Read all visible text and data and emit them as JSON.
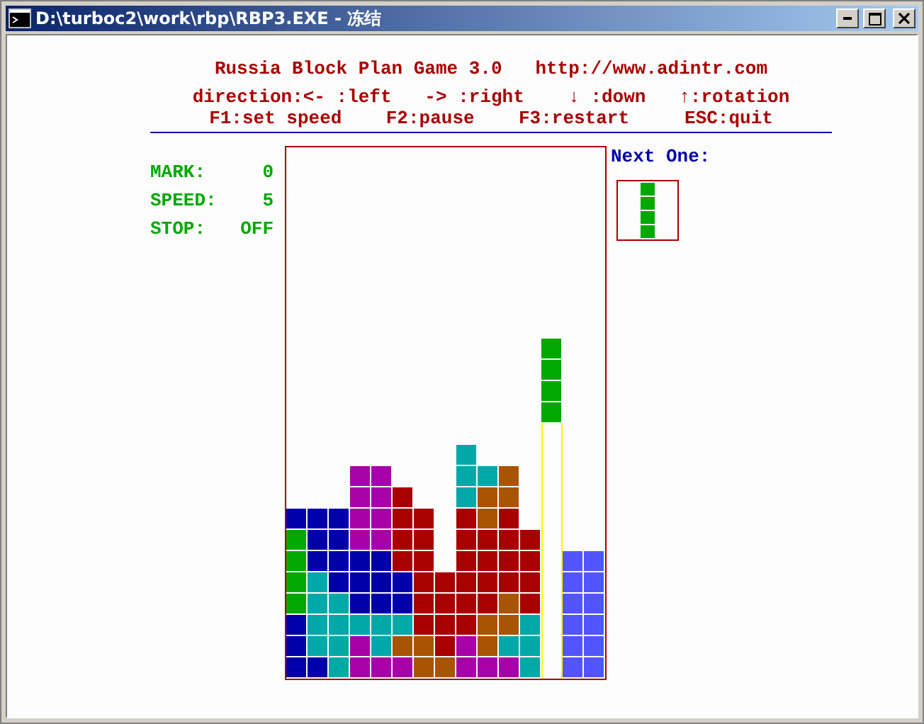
{
  "window": {
    "title": "D:\\turboc2\\work\\rbp\\RBP3.EXE - 冻结"
  },
  "header": {
    "title_line": "Russia Block Plan Game 3.0   http://www.adintr.com",
    "controls_line": "direction:<- :left   -> :right    ↓ :down   ↑:rotation",
    "keys_line": "F1:set speed    F2:pause    F3:restart     ESC:quit"
  },
  "stats": [
    {
      "label": "MARK:",
      "value": "0"
    },
    {
      "label": "SPEED:",
      "value": "5"
    },
    {
      "label": "STOP:",
      "value": "OFF"
    }
  ],
  "board": {
    "rows": [
      {
        "cells": [
          {
            "kind": "empty"
          },
          {
            "kind": "empty"
          },
          {
            "kind": "empty"
          },
          {
            "kind": "empty"
          },
          {
            "kind": "empty"
          },
          {
            "kind": "empty"
          },
          {
            "kind": "empty"
          },
          {
            "kind": "empty"
          },
          {
            "kind": "empty"
          },
          {
            "kind": "empty"
          },
          {
            "kind": "empty"
          },
          {
            "kind": "empty"
          },
          {
            "kind": "falling",
            "color": "#00a800"
          },
          {
            "kind": "empty"
          },
          {
            "kind": "empty"
          }
        ]
      },
      {
        "cells": [
          {
            "kind": "empty"
          },
          {
            "kind": "empty"
          },
          {
            "kind": "empty"
          },
          {
            "kind": "empty"
          },
          {
            "kind": "empty"
          },
          {
            "kind": "empty"
          },
          {
            "kind": "empty"
          },
          {
            "kind": "empty"
          },
          {
            "kind": "empty"
          },
          {
            "kind": "empty"
          },
          {
            "kind": "empty"
          },
          {
            "kind": "empty"
          },
          {
            "kind": "falling",
            "color": "#00a800"
          },
          {
            "kind": "empty"
          },
          {
            "kind": "empty"
          }
        ]
      },
      {
        "cells": [
          {
            "kind": "empty"
          },
          {
            "kind": "empty"
          },
          {
            "kind": "empty"
          },
          {
            "kind": "empty"
          },
          {
            "kind": "empty"
          },
          {
            "kind": "empty"
          },
          {
            "kind": "empty"
          },
          {
            "kind": "empty"
          },
          {
            "kind": "empty"
          },
          {
            "kind": "empty"
          },
          {
            "kind": "empty"
          },
          {
            "kind": "empty"
          },
          {
            "kind": "falling",
            "color": "#00a800"
          },
          {
            "kind": "empty"
          },
          {
            "kind": "empty"
          }
        ]
      },
      {
        "cells": [
          {
            "kind": "empty"
          },
          {
            "kind": "empty"
          },
          {
            "kind": "empty"
          },
          {
            "kind": "empty"
          },
          {
            "kind": "empty"
          },
          {
            "kind": "empty"
          },
          {
            "kind": "empty"
          },
          {
            "kind": "empty"
          },
          {
            "kind": "empty"
          },
          {
            "kind": "empty"
          },
          {
            "kind": "empty"
          },
          {
            "kind": "empty"
          },
          {
            "kind": "falling",
            "color": "#00a800"
          },
          {
            "kind": "empty"
          },
          {
            "kind": "empty"
          }
        ]
      },
      {
        "cells": [
          {
            "kind": "empty"
          },
          {
            "kind": "empty"
          },
          {
            "kind": "empty"
          },
          {
            "kind": "empty"
          },
          {
            "kind": "empty"
          },
          {
            "kind": "empty"
          },
          {
            "kind": "empty"
          },
          {
            "kind": "empty"
          },
          {
            "kind": "empty"
          },
          {
            "kind": "empty"
          },
          {
            "kind": "empty"
          },
          {
            "kind": "empty"
          },
          {
            "kind": "guide"
          },
          {
            "kind": "empty"
          },
          {
            "kind": "empty"
          }
        ]
      },
      {
        "cells": [
          {
            "kind": "empty"
          },
          {
            "kind": "empty"
          },
          {
            "kind": "empty"
          },
          {
            "kind": "empty"
          },
          {
            "kind": "empty"
          },
          {
            "kind": "empty"
          },
          {
            "kind": "empty"
          },
          {
            "kind": "empty"
          },
          {
            "kind": "block",
            "color": "#00a8a8"
          },
          {
            "kind": "empty"
          },
          {
            "kind": "empty"
          },
          {
            "kind": "empty"
          },
          {
            "kind": "guide"
          },
          {
            "kind": "empty"
          },
          {
            "kind": "empty"
          }
        ]
      },
      {
        "cells": [
          {
            "kind": "empty"
          },
          {
            "kind": "empty"
          },
          {
            "kind": "empty"
          },
          {
            "kind": "block",
            "color": "#a800a8"
          },
          {
            "kind": "block",
            "color": "#a800a8"
          },
          {
            "kind": "empty"
          },
          {
            "kind": "empty"
          },
          {
            "kind": "empty"
          },
          {
            "kind": "block",
            "color": "#00a8a8"
          },
          {
            "kind": "block",
            "color": "#00a8a8"
          },
          {
            "kind": "block",
            "color": "#a85400"
          },
          {
            "kind": "empty"
          },
          {
            "kind": "guide"
          },
          {
            "kind": "empty"
          },
          {
            "kind": "empty"
          }
        ]
      },
      {
        "cells": [
          {
            "kind": "empty"
          },
          {
            "kind": "empty"
          },
          {
            "kind": "empty"
          },
          {
            "kind": "block",
            "color": "#a800a8"
          },
          {
            "kind": "block",
            "color": "#a800a8"
          },
          {
            "kind": "block",
            "color": "#a80000"
          },
          {
            "kind": "empty"
          },
          {
            "kind": "empty"
          },
          {
            "kind": "block",
            "color": "#00a8a8"
          },
          {
            "kind": "block",
            "color": "#a85400"
          },
          {
            "kind": "block",
            "color": "#a85400"
          },
          {
            "kind": "empty"
          },
          {
            "kind": "guide"
          },
          {
            "kind": "empty"
          },
          {
            "kind": "empty"
          }
        ]
      },
      {
        "cells": [
          {
            "kind": "block",
            "color": "#0000a8"
          },
          {
            "kind": "block",
            "color": "#0000a8"
          },
          {
            "kind": "block",
            "color": "#0000a8"
          },
          {
            "kind": "block",
            "color": "#a800a8"
          },
          {
            "kind": "block",
            "color": "#a800a8"
          },
          {
            "kind": "block",
            "color": "#a80000"
          },
          {
            "kind": "block",
            "color": "#a80000"
          },
          {
            "kind": "empty"
          },
          {
            "kind": "block",
            "color": "#a80000"
          },
          {
            "kind": "block",
            "color": "#a85400"
          },
          {
            "kind": "block",
            "color": "#a80000"
          },
          {
            "kind": "empty"
          },
          {
            "kind": "guide"
          },
          {
            "kind": "empty"
          },
          {
            "kind": "empty"
          }
        ]
      },
      {
        "cells": [
          {
            "kind": "block",
            "color": "#00a800"
          },
          {
            "kind": "block",
            "color": "#0000a8"
          },
          {
            "kind": "block",
            "color": "#0000a8"
          },
          {
            "kind": "block",
            "color": "#a800a8"
          },
          {
            "kind": "block",
            "color": "#a800a8"
          },
          {
            "kind": "block",
            "color": "#a80000"
          },
          {
            "kind": "block",
            "color": "#a80000"
          },
          {
            "kind": "empty"
          },
          {
            "kind": "block",
            "color": "#a80000"
          },
          {
            "kind": "block",
            "color": "#a80000"
          },
          {
            "kind": "block",
            "color": "#a80000"
          },
          {
            "kind": "block",
            "color": "#a80000"
          },
          {
            "kind": "guide"
          },
          {
            "kind": "empty"
          },
          {
            "kind": "empty"
          }
        ]
      },
      {
        "cells": [
          {
            "kind": "block",
            "color": "#00a800"
          },
          {
            "kind": "block",
            "color": "#0000a8"
          },
          {
            "kind": "block",
            "color": "#0000a8"
          },
          {
            "kind": "block",
            "color": "#0000a8"
          },
          {
            "kind": "block",
            "color": "#0000a8"
          },
          {
            "kind": "block",
            "color": "#a80000"
          },
          {
            "kind": "block",
            "color": "#a80000"
          },
          {
            "kind": "empty"
          },
          {
            "kind": "block",
            "color": "#a80000"
          },
          {
            "kind": "block",
            "color": "#a80000"
          },
          {
            "kind": "block",
            "color": "#a80000"
          },
          {
            "kind": "block",
            "color": "#a80000"
          },
          {
            "kind": "guide"
          },
          {
            "kind": "block",
            "color": "#5454fc"
          },
          {
            "kind": "block",
            "color": "#5454fc"
          }
        ]
      },
      {
        "cells": [
          {
            "kind": "block",
            "color": "#00a800"
          },
          {
            "kind": "block",
            "color": "#00a8a8"
          },
          {
            "kind": "block",
            "color": "#0000a8"
          },
          {
            "kind": "block",
            "color": "#0000a8"
          },
          {
            "kind": "block",
            "color": "#0000a8"
          },
          {
            "kind": "block",
            "color": "#0000a8"
          },
          {
            "kind": "block",
            "color": "#a80000"
          },
          {
            "kind": "block",
            "color": "#a80000"
          },
          {
            "kind": "block",
            "color": "#a80000"
          },
          {
            "kind": "block",
            "color": "#a80000"
          },
          {
            "kind": "block",
            "color": "#a80000"
          },
          {
            "kind": "block",
            "color": "#a80000"
          },
          {
            "kind": "guide"
          },
          {
            "kind": "block",
            "color": "#5454fc"
          },
          {
            "kind": "block",
            "color": "#5454fc"
          }
        ]
      },
      {
        "cells": [
          {
            "kind": "block",
            "color": "#00a800"
          },
          {
            "kind": "block",
            "color": "#00a8a8"
          },
          {
            "kind": "block",
            "color": "#00a8a8"
          },
          {
            "kind": "block",
            "color": "#0000a8"
          },
          {
            "kind": "block",
            "color": "#0000a8"
          },
          {
            "kind": "block",
            "color": "#0000a8"
          },
          {
            "kind": "block",
            "color": "#a80000"
          },
          {
            "kind": "block",
            "color": "#a80000"
          },
          {
            "kind": "block",
            "color": "#a80000"
          },
          {
            "kind": "block",
            "color": "#a80000"
          },
          {
            "kind": "block",
            "color": "#a85400"
          },
          {
            "kind": "block",
            "color": "#a80000"
          },
          {
            "kind": "guide"
          },
          {
            "kind": "block",
            "color": "#5454fc"
          },
          {
            "kind": "block",
            "color": "#5454fc"
          }
        ]
      },
      {
        "cells": [
          {
            "kind": "block",
            "color": "#0000a8"
          },
          {
            "kind": "block",
            "color": "#00a8a8"
          },
          {
            "kind": "block",
            "color": "#00a8a8"
          },
          {
            "kind": "block",
            "color": "#00a8a8"
          },
          {
            "kind": "block",
            "color": "#00a8a8"
          },
          {
            "kind": "block",
            "color": "#00a8a8"
          },
          {
            "kind": "block",
            "color": "#a80000"
          },
          {
            "kind": "block",
            "color": "#a80000"
          },
          {
            "kind": "block",
            "color": "#a80000"
          },
          {
            "kind": "block",
            "color": "#a85400"
          },
          {
            "kind": "block",
            "color": "#a85400"
          },
          {
            "kind": "block",
            "color": "#00a8a8"
          },
          {
            "kind": "guide"
          },
          {
            "kind": "block",
            "color": "#5454fc"
          },
          {
            "kind": "block",
            "color": "#5454fc"
          }
        ]
      },
      {
        "cells": [
          {
            "kind": "block",
            "color": "#0000a8"
          },
          {
            "kind": "block",
            "color": "#00a8a8"
          },
          {
            "kind": "block",
            "color": "#00a8a8"
          },
          {
            "kind": "block",
            "color": "#a800a8"
          },
          {
            "kind": "block",
            "color": "#00a8a8"
          },
          {
            "kind": "block",
            "color": "#a85400"
          },
          {
            "kind": "block",
            "color": "#a85400"
          },
          {
            "kind": "block",
            "color": "#a80000"
          },
          {
            "kind": "block",
            "color": "#a800a8"
          },
          {
            "kind": "block",
            "color": "#a85400"
          },
          {
            "kind": "block",
            "color": "#00a8a8"
          },
          {
            "kind": "block",
            "color": "#00a8a8"
          },
          {
            "kind": "guide"
          },
          {
            "kind": "block",
            "color": "#5454fc"
          },
          {
            "kind": "block",
            "color": "#5454fc"
          }
        ]
      },
      {
        "cells": [
          {
            "kind": "block",
            "color": "#0000a8"
          },
          {
            "kind": "block",
            "color": "#0000a8"
          },
          {
            "kind": "block",
            "color": "#00a8a8"
          },
          {
            "kind": "block",
            "color": "#a800a8"
          },
          {
            "kind": "block",
            "color": "#a800a8"
          },
          {
            "kind": "block",
            "color": "#a800a8"
          },
          {
            "kind": "block",
            "color": "#a85400"
          },
          {
            "kind": "block",
            "color": "#a85400"
          },
          {
            "kind": "block",
            "color": "#a800a8"
          },
          {
            "kind": "block",
            "color": "#a800a8"
          },
          {
            "kind": "block",
            "color": "#a800a8"
          },
          {
            "kind": "block",
            "color": "#00a8a8"
          },
          {
            "kind": "guide"
          },
          {
            "kind": "block",
            "color": "#5454fc"
          },
          {
            "kind": "block",
            "color": "#5454fc"
          }
        ]
      }
    ]
  },
  "next_piece": {
    "label": "Next One:",
    "cells": [
      {
        "color": "#00a800"
      },
      {
        "color": "#00a800"
      },
      {
        "color": "#00a800"
      },
      {
        "color": "#00a800"
      }
    ]
  }
}
